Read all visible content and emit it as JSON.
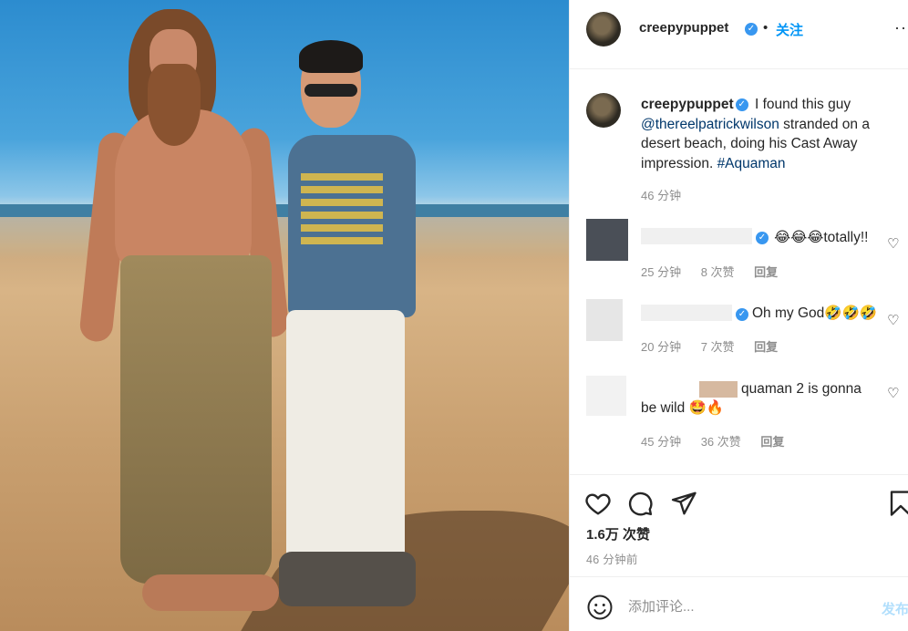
{
  "post": {
    "username": "creepypuppet",
    "follow_label": "关注",
    "dot": "•",
    "more": "···"
  },
  "caption": {
    "username": "creepypuppet",
    "text_a": "I found this guy",
    "mention": "@thereelpatrickwilson",
    "text_b": "stranded on a desert beach, doing his Cast Away impression.",
    "hashtag": "#Aquaman",
    "time": "46 分钟"
  },
  "comments": [
    {
      "text": "😂😂😂totally!!",
      "time": "25 分钟",
      "likes": "8 次赞",
      "reply": "回复"
    },
    {
      "text": "Oh my God🤣🤣🤣",
      "time": "20 分钟",
      "likes": "7 次赞",
      "reply": "回复"
    },
    {
      "text": "quaman 2 is gonna be wild 🤩🔥",
      "time": "45 分钟",
      "likes": "36 次赞",
      "reply": "回复"
    }
  ],
  "stats": {
    "likes": "1.6万 次赞",
    "posted_ago": "46 分钟前"
  },
  "composer": {
    "placeholder": "添加评论...",
    "post_label": "发布"
  },
  "colors": {
    "accent": "#0095f6",
    "verified": "#3897f0",
    "muted": "#8e8e8e"
  }
}
